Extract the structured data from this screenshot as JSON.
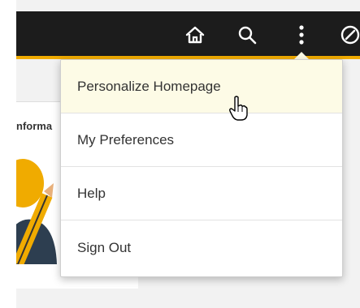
{
  "header": {
    "home_icon": "home-icon",
    "search_icon": "search-icon",
    "actions_icon": "kebab-vertical-icon",
    "navbar_icon": "compass-icon",
    "bar_color": "#1c1c1c",
    "accent_color": "#f0ab00"
  },
  "tile": {
    "title": "nforma"
  },
  "actions_menu": {
    "items": [
      {
        "label": "Personalize Homepage",
        "highlighted": true
      },
      {
        "label": "My Preferences",
        "highlighted": false
      },
      {
        "label": "Help",
        "highlighted": false
      },
      {
        "label": "Sign Out",
        "highlighted": false
      }
    ],
    "highlight_color": "#fdfbe6"
  },
  "pointer": {
    "icon": "hand-pointer-icon"
  }
}
